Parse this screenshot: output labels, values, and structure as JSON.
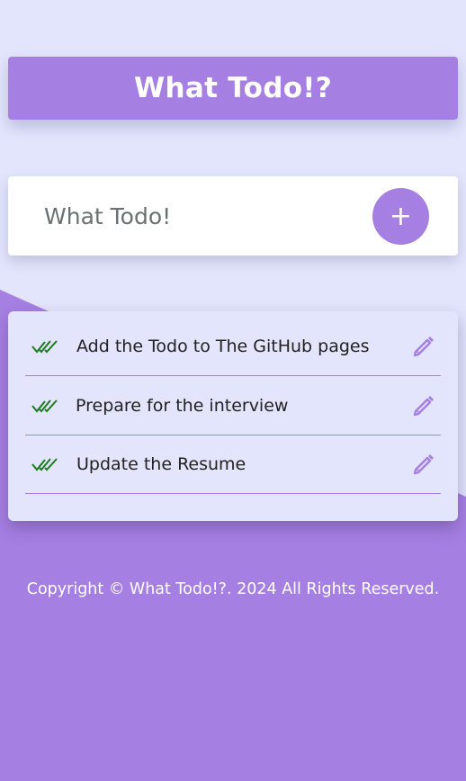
{
  "header": {
    "title": "What Todo!?"
  },
  "input": {
    "placeholder": "What Todo!",
    "add_label": "+"
  },
  "todos": [
    {
      "text": "Add the Todo to The GitHub pages"
    },
    {
      "text": "Prepare for the interview"
    },
    {
      "text": "Update the Resume"
    }
  ],
  "icons": {
    "check": "double-check-icon",
    "edit": "pencil-icon",
    "add": "plus-icon"
  },
  "footer": {
    "text": "Copyright © What Todo!?.  2024 All Rights Reserved."
  },
  "colors": {
    "accent": "#a67fe2",
    "background": "#e2e5fb",
    "check": "#1e7a1e"
  }
}
